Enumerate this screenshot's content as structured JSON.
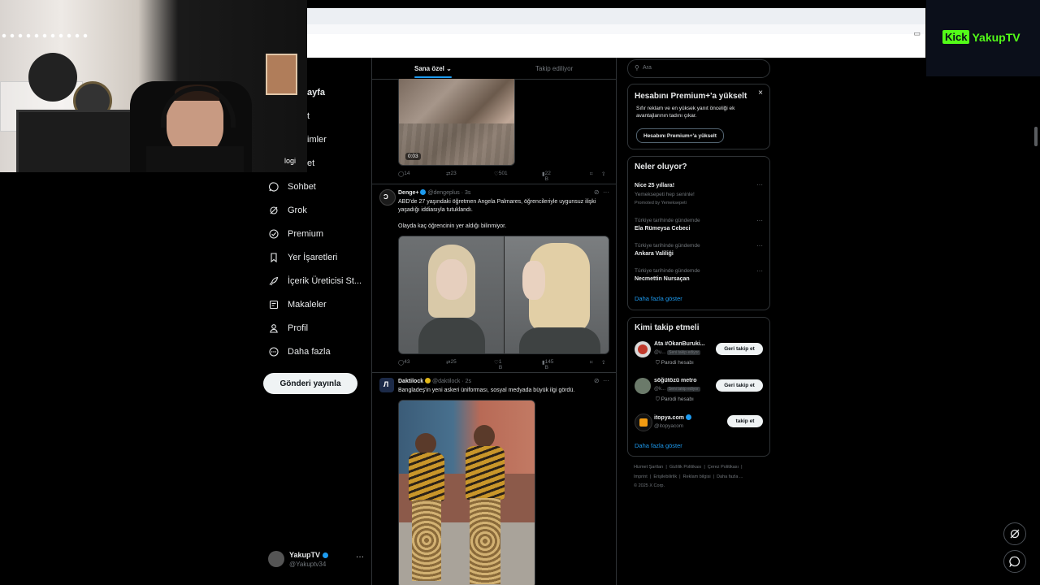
{
  "stream": {
    "platform_label": "Kick",
    "channel_label": "YakupTV"
  },
  "nav": {
    "partial_home": "ayfa",
    "partial_explore": "t",
    "partial_notifications": "imler",
    "partial_messages": "et",
    "overlay_text": "logi",
    "items": [
      {
        "label": "Sohbet",
        "icon": "chat-icon"
      },
      {
        "label": "Grok",
        "icon": "grok-icon"
      },
      {
        "label": "Premium",
        "icon": "premium-icon"
      },
      {
        "label": "Yer İşaretleri",
        "icon": "bookmark-icon"
      },
      {
        "label": "İçerik Üreticisi St...",
        "icon": "rocket-icon"
      },
      {
        "label": "Makaleler",
        "icon": "articles-icon"
      },
      {
        "label": "Profil",
        "icon": "profile-icon"
      },
      {
        "label": "Daha fazla",
        "icon": "more-circle-icon"
      }
    ],
    "post_button": "Gönderi yayınla",
    "account": {
      "name": "YakupTV",
      "handle": "@Yakuptv34",
      "more": "···"
    }
  },
  "timeline": {
    "tabs": [
      {
        "label": "Sana özel ⌄",
        "active": true
      },
      {
        "label": "Takip ediliyor",
        "active": false
      }
    ],
    "tweets": [
      {
        "video_duration": "0:03",
        "replies": "14",
        "reposts": "23",
        "likes": "501",
        "views": "22 B"
      },
      {
        "name": "Denge+",
        "handle": "@dengeplus · 3s",
        "text": "ABD'de 27 yaşındaki öğretmen Angela Palmares, öğrencileriyle uygunsuz ilişki yaşadığı iddiasıyla tutuklandı.",
        "text2": "Olayda kaç öğrencinin yer aldığı bilinmiyor.",
        "replies": "43",
        "reposts": "25",
        "likes": "1 B",
        "views": "145 B"
      },
      {
        "name": "Daktilock",
        "handle": "@daktilock · 2s",
        "text": "Bangladeş'in yeni askeri üniforması, sosyal medyada büyük ilgi gördü."
      }
    ]
  },
  "search": {
    "placeholder": "Ara"
  },
  "premium_card": {
    "title": "Hesabını Premium+'a yükselt",
    "body": "Sıfır reklam ve en yüksek yanıt önceliği ek avantajlarının tadını çıkar.",
    "button": "Hesabını Premium+'a yükselt",
    "close": "×"
  },
  "trends": {
    "title": "Neler oluyor?",
    "items": [
      {
        "context": "",
        "title": "Nice 25 yıllara!",
        "sub": "Yemeksepeti hep seninle!",
        "promo": "Promoted by Yemeksepeti"
      },
      {
        "context": "Türkiye tarihinde gündemde",
        "title": "Ela Rümeysa Cebeci"
      },
      {
        "context": "Türkiye tarihinde gündemde",
        "title": "Ankara Valiliği"
      },
      {
        "context": "Türkiye tarihinde gündemde",
        "title": "Necmettin Nursaçan"
      }
    ],
    "show_more": "Daha fazla göster"
  },
  "who_to_follow": {
    "title": "Kimi takip etmeli",
    "items": [
      {
        "name": "Ata #OkanBuruki...",
        "handle": "@u...",
        "chip": "Seni takip ediyor",
        "note": "Parodi hesabı",
        "button": "Geri takip et"
      },
      {
        "name": "söğütözü metro",
        "handle": "@k...",
        "chip": "Seni takip ediyor",
        "note": "Parodi hesabı",
        "button": "Geri takip et"
      },
      {
        "name": "itopya.com",
        "handle": "@itopyacom",
        "chip": "",
        "note": "",
        "button": "takip et"
      }
    ],
    "show_more": "Daha fazla göster"
  },
  "footer": {
    "line1": "Hizmet Şartları  |  Gizlilik Politikası  |  Çerez Politikası  |",
    "line2": "Imprint  |  Erişilebilirlik  |  Reklam bilgisi  |  Daha fazla ...",
    "line3": "© 2025 X Corp."
  },
  "colors": {
    "accent": "#1d9bf0",
    "kick_green": "#53fc18",
    "border": "#2f3336"
  }
}
